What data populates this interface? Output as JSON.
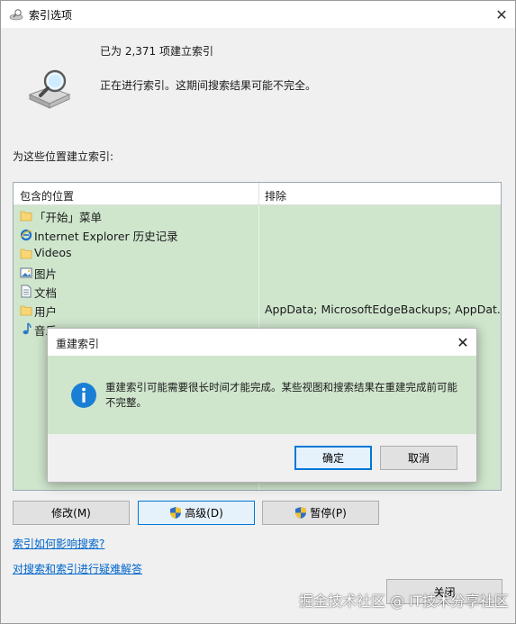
{
  "window": {
    "title": "索引选项",
    "close_glyph": "✕"
  },
  "status": {
    "count": "已为 2,371 项建立索引",
    "message": "正在进行索引。这期间搜索结果可能不完全。"
  },
  "locations": {
    "label": "为这些位置建立索引:",
    "headers": {
      "included": "包含的位置",
      "excluded": "排除"
    },
    "rows": [
      {
        "name": "「开始」菜单",
        "icon": "folder-icon",
        "exclude": ""
      },
      {
        "name": "Internet Explorer 历史记录",
        "icon": "ie-icon",
        "exclude": ""
      },
      {
        "name": "Videos",
        "icon": "folder-icon",
        "exclude": ""
      },
      {
        "name": "图片",
        "icon": "pictures-icon",
        "exclude": ""
      },
      {
        "name": "文档",
        "icon": "documents-icon",
        "exclude": ""
      },
      {
        "name": "用户",
        "icon": "folder-icon",
        "exclude": "AppData; MicrosoftEdgeBackups; AppDat..."
      },
      {
        "name": "音乐",
        "icon": "music-icon",
        "exclude": ""
      }
    ]
  },
  "buttons": {
    "modify": "修改(M)",
    "advanced": "高级(D)",
    "pause": "暂停(P)",
    "close": "关闭"
  },
  "links": {
    "how_indexing": "索引如何影响搜索?",
    "troubleshoot": "对搜索和索引进行疑难解答"
  },
  "dialog": {
    "title": "重建索引",
    "close_glyph": "✕",
    "message": "重建索引可能需要很长时间才能完成。某些视图和搜索结果在重建完成前可能不完整。",
    "ok": "确定",
    "cancel": "取消"
  },
  "watermark": "掘金技术社区 @ IT技术分享社区",
  "colors": {
    "accent": "#0078d7",
    "highlight_green": "#cfe6cd",
    "link": "#0066cc",
    "info_blue": "#1a7fd4"
  }
}
